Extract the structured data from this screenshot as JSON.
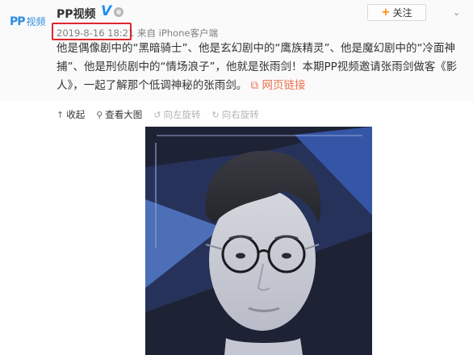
{
  "post": {
    "logo_mark": "PP",
    "logo_text": "视频",
    "author": "PP视频",
    "verified_mark": "V",
    "follow_label": "关注",
    "timestamp": "2019-8-16 18:21",
    "source": "来自 iPhone客户端",
    "content": "他是偶像剧中的“黑暗骑士”、他是玄幻剧中的“鹰族精灵”、他是魔幻剧中的“冷面神捕”、他是刑侦剧中的“情场浪子”，他就是张雨剑！本期PP视频邀请张雨剑做客《影人》，一起了解那个低调神秘的张雨剑。",
    "link_icon": "link-icon",
    "link_text": "网页链接"
  },
  "toolbar": {
    "items": [
      {
        "icon": "↑",
        "label": "收起"
      },
      {
        "icon": "⚲",
        "label": "查看大图"
      },
      {
        "icon": "↺",
        "label": "向左旋转"
      },
      {
        "icon": "↻",
        "label": "向右旋转"
      }
    ]
  },
  "colors": {
    "accent_orange": "#eb7350",
    "highlight_red": "#e0262e",
    "verified_blue": "#1f8ef1"
  }
}
